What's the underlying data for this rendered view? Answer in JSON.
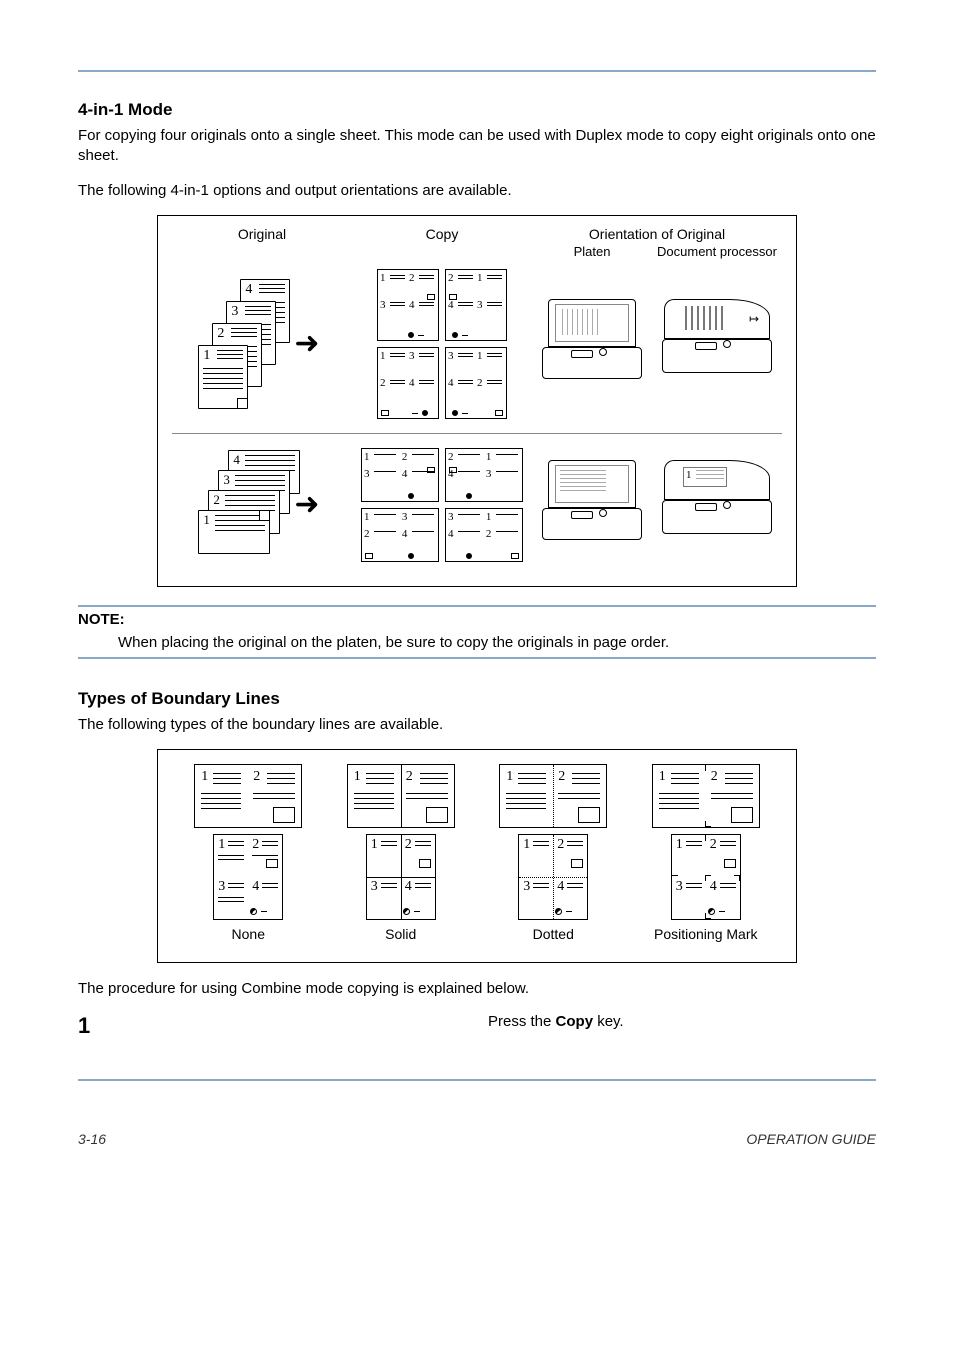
{
  "sec1_title": "4-in-1 Mode",
  "para1": "For copying four originals onto a single sheet. This mode can be used with Duplex mode to copy eight originals onto one sheet.",
  "para2": "The following 4-in-1 options and output orientations are available.",
  "diagram": {
    "h_original": "Original",
    "h_copy": "Copy",
    "h_orient": "Orientation of Original",
    "h_platen": "Platen",
    "h_docproc": "Document processor",
    "nums": {
      "n1": "1",
      "n2": "2",
      "n3": "3",
      "n4": "4"
    }
  },
  "note_label": "NOTE:",
  "note_text": "When placing the original on the platen, be sure to copy the originals in page order.",
  "sec2_title": "Types of Boundary Lines",
  "para3": "The following types of the boundary lines are available.",
  "boundary": {
    "none": "None",
    "solid": "Solid",
    "dotted": "Dotted",
    "posmark": "Positioning Mark",
    "n1": "1",
    "n2": "2",
    "n3": "3",
    "n4": "4"
  },
  "para4": "The procedure for using Combine mode copying is explained below.",
  "step_num": "1",
  "step_a": "Press the ",
  "step_key": "Copy",
  "step_b": " key.",
  "footer_left": "3-16",
  "footer_right": "OPERATION GUIDE"
}
